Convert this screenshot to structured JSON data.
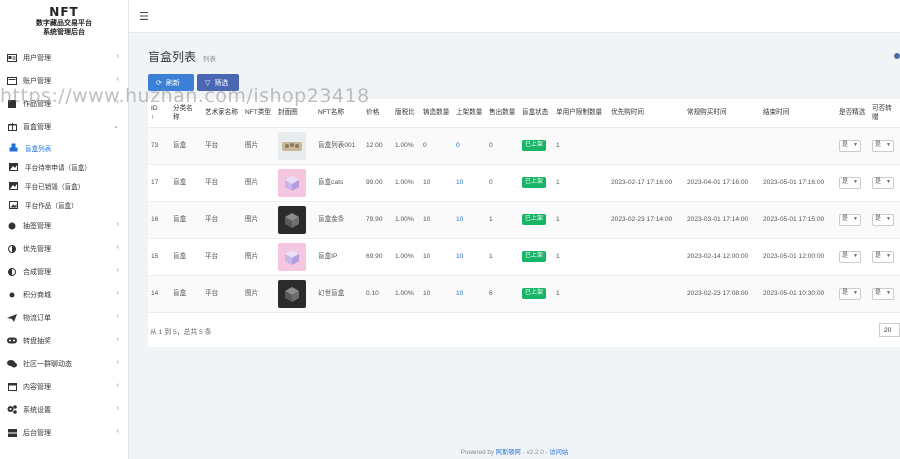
{
  "logo": {
    "mark": "NFT",
    "line1": "数字藏品交易平台",
    "line2": "系统管理后台"
  },
  "topbar": {
    "menu_icon": "hamburger-icon"
  },
  "sidebar": {
    "items": [
      {
        "label": "用户管理",
        "icon": "id-card-icon"
      },
      {
        "label": "账户管理",
        "icon": "wallet-icon"
      },
      {
        "label": "作品管理",
        "icon": "square-icon"
      },
      {
        "label": "盲盒管理",
        "icon": "gift-icon"
      },
      {
        "label": "抽签管理",
        "icon": "circle-icon"
      },
      {
        "label": "优先管理",
        "icon": "half-circle-icon"
      },
      {
        "label": "合成管理",
        "icon": "half-circle-icon"
      },
      {
        "label": "积分商城",
        "icon": "dot-icon"
      },
      {
        "label": "物流订单",
        "icon": "plane-icon"
      },
      {
        "label": "转盘抽奖",
        "icon": "gamepad-icon"
      },
      {
        "label": "社区一群聊动态",
        "icon": "chat-icon"
      },
      {
        "label": "内容管理",
        "icon": "window-icon"
      },
      {
        "label": "系统设置",
        "icon": "cogs-icon"
      },
      {
        "label": "后台管理",
        "icon": "server-icon"
      }
    ],
    "sub_items": [
      {
        "label": "盲盒列表",
        "icon": "cubes-icon"
      },
      {
        "label": "平台待审申请（盲盒）",
        "icon": "image-icon"
      },
      {
        "label": "平台已销毁（盲盒）",
        "icon": "image-icon"
      },
      {
        "label": "平台作品（盲盒）",
        "icon": "image-icon"
      }
    ]
  },
  "page": {
    "title": "盲盒列表",
    "subtitle": "列表"
  },
  "toolbar": {
    "refresh_label": "刷新",
    "filter_label": "筛选"
  },
  "table": {
    "headers": [
      "ID",
      "分类名称",
      "艺术家名称",
      "NFT类型",
      "封面图",
      "NFT名称",
      "价格",
      "版税比",
      "铸造数量",
      "上架数量",
      "售出数量",
      "盲盒状态",
      "单用户限制数量",
      "优先购时间",
      "常规购买时间",
      "结束时间",
      "是否精选",
      "可否转赠"
    ],
    "rows": [
      {
        "id": "73",
        "category": "盲盒",
        "artist": "平台",
        "type": "图片",
        "thumb": "light",
        "name": "盲盒列表001",
        "price": "12.00",
        "royalty": "1.00%",
        "minted": "0",
        "listed": "0",
        "sold": "0",
        "status": "已上架",
        "limit": "1",
        "priority_time": "",
        "regular_time": "",
        "end_time": "",
        "featured": "是",
        "transfer": "是"
      },
      {
        "id": "17",
        "category": "盲盒",
        "artist": "平台",
        "type": "图片",
        "thumb": "pink",
        "name": "盲盒cats",
        "price": "99.00",
        "royalty": "1.00%",
        "minted": "10",
        "listed": "10",
        "sold": "0",
        "status": "已上架",
        "limit": "1",
        "priority_time": "2023-02-17 17:16:00",
        "regular_time": "2023-04-01 17:16:00",
        "end_time": "2023-05-01 17:16:00",
        "featured": "是",
        "transfer": "是"
      },
      {
        "id": "16",
        "category": "盲盒",
        "artist": "平台",
        "type": "图片",
        "thumb": "dark",
        "name": "盲盒金条",
        "price": "79.90",
        "royalty": "1.00%",
        "minted": "10",
        "listed": "10",
        "sold": "1",
        "status": "已上架",
        "limit": "1",
        "priority_time": "2023-02-23 17:14:00",
        "regular_time": "2023-03-01 17:14:00",
        "end_time": "2023-05-01 17:15:00",
        "featured": "是",
        "transfer": "是"
      },
      {
        "id": "15",
        "category": "盲盒",
        "artist": "平台",
        "type": "图片",
        "thumb": "pink",
        "name": "盲盒IP",
        "price": "69.90",
        "royalty": "1.00%",
        "minted": "10",
        "listed": "10",
        "sold": "1",
        "status": "已上架",
        "limit": "1",
        "priority_time": "",
        "regular_time": "2023-02-14 12:00:00",
        "end_time": "2023-05-01 12:00:00",
        "featured": "是",
        "transfer": "是"
      },
      {
        "id": "14",
        "category": "盲盒",
        "artist": "平台",
        "type": "图片",
        "thumb": "dark",
        "name": "幻世盲盒",
        "price": "0.10",
        "royalty": "1.00%",
        "minted": "10",
        "listed": "10",
        "sold": "6",
        "status": "已上架",
        "limit": "1",
        "priority_time": "",
        "regular_time": "2023-02-23 17:08:00",
        "end_time": "2023-05-01 10:30:00",
        "featured": "是",
        "transfer": "是"
      }
    ]
  },
  "pager": {
    "info": "从 1 到 5，总共 5 条",
    "page_size": "20"
  },
  "footer": {
    "prefix": "Powered by ",
    "brand": "阿斯顿阿",
    "version": " - v2.2.0 - ",
    "link": "访问站"
  },
  "watermark": "https://www.huzhan.com/ishop23418",
  "colors": {
    "primary": "#3c7fd6",
    "success": "#18b566",
    "sidebar_bg": "#ffffff"
  }
}
